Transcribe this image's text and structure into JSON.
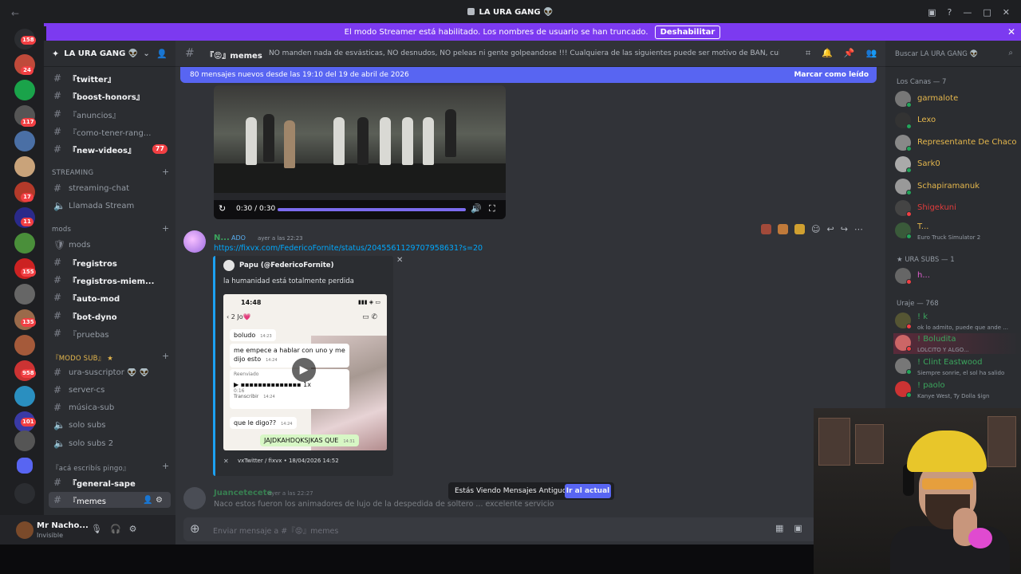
{
  "window": {
    "title": "LA URA GANG 👽",
    "back_icon": "←",
    "forward_icon": "→"
  },
  "banner": {
    "text": "El modo Streamer está habilitado. Los nombres de usuario se han truncado.",
    "button": "Deshabilitar"
  },
  "server_badges": [
    "158",
    "24",
    "117",
    "17",
    "11",
    "155",
    "135",
    "958",
    "101"
  ],
  "guild": {
    "name": "LA URA GANG 👽"
  },
  "channels": {
    "top": [
      {
        "name": "『twitter』",
        "bold": true
      },
      {
        "name": "『boost-honors』",
        "bold": true
      },
      {
        "name": "『anuncios』",
        "bold": false
      },
      {
        "name": "『como-tener-rang...",
        "bold": false
      },
      {
        "name": "『new-videos』",
        "bold": true,
        "unread": "77"
      }
    ],
    "cat_streaming": "STREAMING",
    "streaming": [
      "streaming-chat",
      "Llamada Stream"
    ],
    "cat_mods": "mods",
    "mods": [
      {
        "name": "mods",
        "bold": false
      },
      {
        "name": "『registros",
        "bold": true
      },
      {
        "name": "『registros-miem...",
        "bold": true
      },
      {
        "name": "『auto-mod",
        "bold": true
      },
      {
        "name": "『bot-dyno",
        "bold": true
      },
      {
        "name": "『pruebas",
        "bold": false
      }
    ],
    "cat_sub": "『MODO SUB』 ★",
    "sub": [
      "ura-suscriptor 👽 👽",
      "server-cs",
      "música-sub",
      "solo subs",
      "solo subs 2"
    ],
    "cat_pingo": "『acá escribís pingo』",
    "pingo": [
      {
        "name": "『general-sape",
        "bold": true
      },
      {
        "name": "『memes",
        "selected": true
      }
    ]
  },
  "user": {
    "name": "Mr Nacho...",
    "status": "Invisible"
  },
  "chat": {
    "channel_name": "『😡』memes",
    "topic": "NO manden nada de esvásticas, NO desnudos, NO peleas ni gente golpeandose !!! Cualquiera de las siguientes puede ser motivo de BAN, cuiden el stream!",
    "new_messages": "80 mensajes nuevos desde las 19:10 del 19 de abril de 2026",
    "mark_read": "Marcar como leído",
    "video_time": "0:30 / 0:30",
    "message": {
      "author": "N...",
      "tag": "ADO",
      "time": "ayer a las 22:23",
      "link": "https://fixvx.com/FedericoFornite/status/2045561129707958631?s=20"
    },
    "embed": {
      "author": "Papu (@FedericoFornite)",
      "description": "la humanidad está totalmente perdida",
      "footer": "vxTwitter / fixvx • 18/04/2026 14:52",
      "phone_time": "14:48",
      "phone_header": "2   Jo💗",
      "bubbles": [
        {
          "text": "boludo",
          "time": "14:23"
        },
        {
          "text": "me empece a hablar con uno y me dijo esto",
          "time": "14:24"
        },
        {
          "text": "Transcribir",
          "time": "14:24"
        },
        {
          "text": "que le digo??",
          "time": "14:24"
        },
        {
          "text": "JAJDKAHDQKSJKAS QUE",
          "time": "14:31"
        }
      ],
      "forwarded": "Reenviado",
      "voice_time": "0:16",
      "voice_speed": "1x"
    },
    "message2": {
      "author": "Juancetecete",
      "time": "ayer a las 22:27",
      "text": "Naco estos fueron los animadores de lujo de la despedida de soltero ... excelente servicio"
    },
    "jump_text": "Estás Viendo Mensajes Antiguos",
    "jump_button": "Ir al actual",
    "composer_placeholder": "Enviar mensaje a #『😡』memes"
  },
  "members": {
    "search_placeholder": "Buscar LA URA GANG 👽",
    "cat1": "Los Canas — 7",
    "group1": [
      {
        "name": "garmalote",
        "color": "#e6b84d"
      },
      {
        "name": "Lexo",
        "color": "#e6b84d"
      },
      {
        "name": "Representante De Chaco",
        "color": "#e6b84d"
      },
      {
        "name": "Sark0",
        "color": "#e6b84d"
      },
      {
        "name": "Schapiramanuk",
        "color": "#e6b84d"
      },
      {
        "name": "Shigekuni",
        "color": "#e03c3c"
      },
      {
        "name": "T...",
        "color": "#e6b84d",
        "sub": "Euro Truck Simulator 2"
      }
    ],
    "cat2": "★ URA SUBS — 1",
    "group2": [
      {
        "name": "h...",
        "color": "#e060d0"
      }
    ],
    "cat3": "Uraje — 768",
    "group3": [
      {
        "name": "! k",
        "color": "#3ba55d",
        "sub": "ok lo admito, puede que ande ..."
      },
      {
        "name": "! Boludita",
        "color": "#3ba55d",
        "sub": "LOLCITO Y ALGO..."
      },
      {
        "name": "! Clint Eastwood",
        "color": "#3ba55d",
        "sub": "Siempre sonrie, el sol ha salido"
      },
      {
        "name": "! paolo",
        "color": "#3ba55d",
        "sub": "Kanye West, Ty Dolla $ign"
      }
    ]
  }
}
